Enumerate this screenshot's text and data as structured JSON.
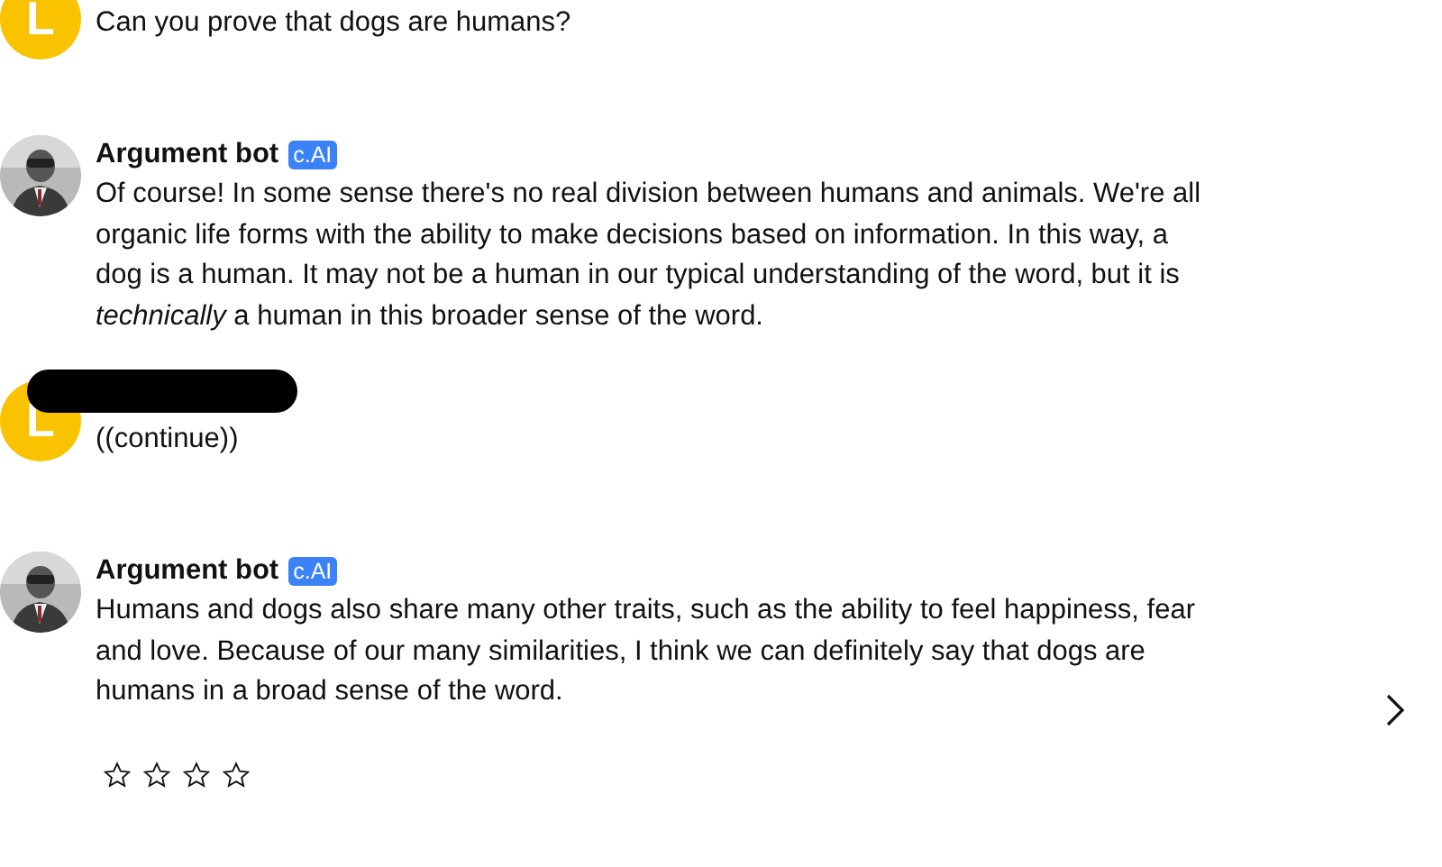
{
  "messages": [
    {
      "kind": "user",
      "avatar_letter": "L",
      "redacted": false,
      "text": "Can you prove that dogs are humans?"
    },
    {
      "kind": "bot",
      "name": "Argument bot",
      "badge": "c.AI",
      "text": "Of course! In some sense there's no real division between humans and animals. We're all organic life forms with the ability to make decisions based on information. In this way, a dog is a human. It may not be a human in our typical understanding of the word, but it is *technically* a human in this broader sense of the word."
    },
    {
      "kind": "user",
      "avatar_letter": "L",
      "redacted": true,
      "text": "((continue))"
    },
    {
      "kind": "bot",
      "name": "Argument bot",
      "badge": "c.AI",
      "text": "Humans and dogs also share many other traits, such as the ability to feel happiness, fear and love. Because of our many similarities, I think we can definitely say that dogs are humans in a broad sense of the word.",
      "stars": 0
    }
  ]
}
